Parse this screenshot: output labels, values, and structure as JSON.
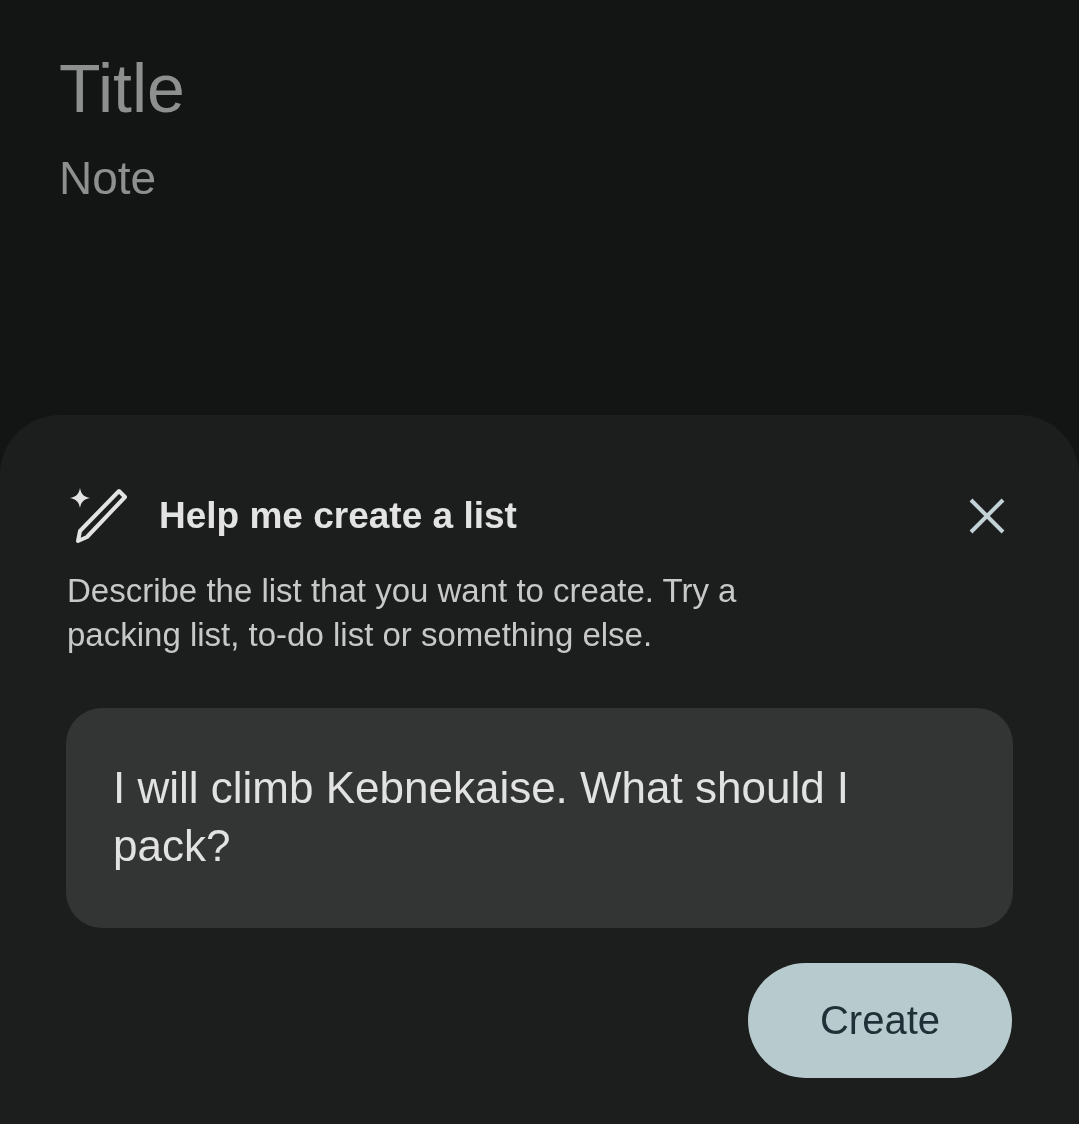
{
  "note": {
    "title_field": {
      "placeholder": "Title"
    },
    "body_field": {
      "placeholder": "Note"
    }
  },
  "sheet": {
    "heading": "Help me create a list",
    "description": "Describe the list that you want to create. Try a packing list, to-do list or something else.",
    "prompt_field": {
      "value": "I will climb Kebnekaise. What should I pack?"
    },
    "create_button": "Create"
  }
}
